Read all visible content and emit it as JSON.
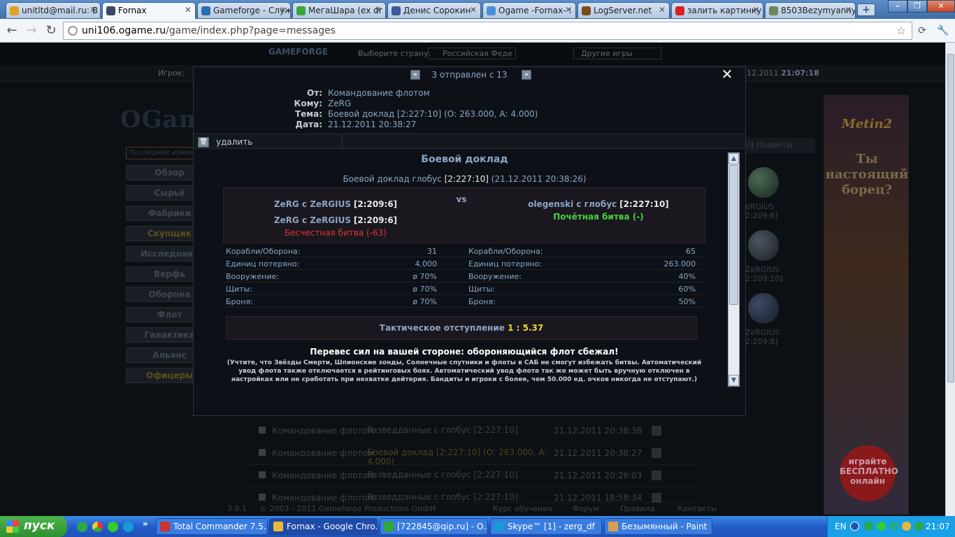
{
  "browser": {
    "tabs": [
      {
        "label": "unitltd@mail.ru: В",
        "color": "#e3a021"
      },
      {
        "label": "Fornax",
        "color": "#3a4a66"
      },
      {
        "label": "Gameforge - Служ",
        "color": "#2a6db0"
      },
      {
        "label": "МегаШара (ex dr",
        "color": "#3aa53a"
      },
      {
        "label": "Денис Сорокин",
        "color": "#3b5998"
      },
      {
        "label": "Ogame -Fornax- :",
        "color": "#4a90d9"
      },
      {
        "label": "LogServer.net",
        "color": "#7a4a1a"
      },
      {
        "label": "залить картинку",
        "color": "#d92020"
      },
      {
        "label": "8503Bezymyannyi",
        "color": "#6a8a5a"
      }
    ],
    "new_tab": "+",
    "window_buttons": [
      "–",
      "❐",
      "✕"
    ],
    "back": "←",
    "forward": "→",
    "reload": "↻",
    "url_host": "uni106.ogame.ru",
    "url_path": "/game/index.php?page=messages",
    "star": "☆",
    "wrench": "🔧"
  },
  "page": {
    "gameforge_logo": "GAMEFORGE",
    "country_label": "Выберите страну:",
    "country_value": "Российская Феде",
    "other_games": "Другие игры",
    "player_label": "Игрок:",
    "server_time": "12.2011",
    "server_clock": "21:07:18",
    "ogame_logo": "OGam",
    "search_placeholder": "Последние измен",
    "menu": [
      {
        "label": "Обзор",
        "gold": false
      },
      {
        "label": "Сырьё",
        "gold": false
      },
      {
        "label": "Фабрики",
        "gold": false
      },
      {
        "label": "Скупщик",
        "gold": true
      },
      {
        "label": "Исследован",
        "gold": false
      },
      {
        "label": "Верфь",
        "gold": false
      },
      {
        "label": "Оборона",
        "gold": false
      },
      {
        "label": "Флот",
        "gold": false
      },
      {
        "label": "Галактика",
        "gold": false
      },
      {
        "label": "Альянс",
        "gold": false
      },
      {
        "label": "Офицеры",
        "gold": true
      }
    ],
    "planets_header": "/3 Планеты",
    "planets": [
      {
        "name": "eRGIUS",
        "coords": "2:209:6]"
      },
      {
        "name": "ZeRGIUS",
        "coords": "2:209:10]"
      },
      {
        "name": "ZeRGIUS",
        "coords": "2:209:8]"
      }
    ],
    "ad": {
      "brand": "Metin2",
      "line1": "Ты",
      "line2": "настоящий",
      "line3": "борец?",
      "badge1": "играйте",
      "badge2": "БЕСПЛАТНО",
      "badge3": "онлайн"
    },
    "messages": [
      {
        "from": "Командование флотом",
        "subject": "Разведданные с глобус [2:227:10]",
        "date": "21.12.2011 20:38:38"
      },
      {
        "from": "Командование флотом",
        "subject": "Боевой доклад [2:227:10] (О: 263.000, А: 4.000)",
        "date": "21.12.2011 20:38:27"
      },
      {
        "from": "Командование флотом",
        "subject": "Разведданные с глобус [2:227:10]",
        "date": "21.12.2011 20:26:03"
      },
      {
        "from": "Командование флотом",
        "subject": "Разведданные с глобус [2:227:10]",
        "date": "21.12.2011 18:58:34"
      }
    ],
    "footer": {
      "version": "3.0.1",
      "copyright": "© 2003 - 2011 Gameforge Productions GmbH",
      "links": [
        "Курс обучения",
        "Форум",
        "Правила",
        "Контакты"
      ]
    }
  },
  "modal": {
    "pager_text": "3 отправлен с",
    "pager_current": "3",
    "pager_total": "13",
    "prev_symbol": "«",
    "next_symbol": "»",
    "close_symbol": "✕",
    "header": [
      {
        "label": "От:",
        "value": "Командование флотом"
      },
      {
        "label": "Кому:",
        "value": "ZeRG"
      },
      {
        "label": "Тема:",
        "value": "Боевой доклад [2:227:10] (О: 263.000, А: 4.000)"
      },
      {
        "label": "Дата:",
        "value": "21.12.2011 20:38:27"
      }
    ],
    "delete_label": "удалить",
    "report": {
      "title": "Боевой доклад",
      "subtitle_pre": "Боевой доклад глобус",
      "subtitle_coords": "[2:227:10]",
      "subtitle_date": "(21.12.2011 20:38:26)",
      "vs": "vs",
      "attacker": {
        "line1_name": "ZeRG с ZeRGIUS",
        "line1_coords": "[2:209:6]",
        "line2_name": "ZeRG с ZeRGIUS",
        "line2_coords": "[2:209:6]",
        "honor": "Бесчестная битва",
        "honor_val": "(-63)"
      },
      "defender": {
        "name": "olegenski с глобус",
        "coords": "[2:227:10]",
        "honor": "Почётная битва (-)"
      },
      "stats": [
        {
          "label": "Корабли/Оборона:",
          "att": "31",
          "def": "65"
        },
        {
          "label": "Единиц потеряно:",
          "att": "4.000",
          "def": "263.000"
        },
        {
          "label": "Вооружение:",
          "att": "ø 70%",
          "def": "40%"
        },
        {
          "label": "Щиты:",
          "att": "ø 70%",
          "def": "60%"
        },
        {
          "label": "Броня:",
          "att": "ø 70%",
          "def": "50%"
        }
      ],
      "retreat_label": "Тактическое отступление",
      "retreat_value": "1 : 5.37",
      "note_head": "Перевес сил на вашей стороне: обороняющийся флот сбежал!",
      "note_text": "(Учтите, что Звёзды Смерти, Шпионские зонды, Солнечные спутники и флоты в САБ не смогут избежать битвы. Автоматический увод флота также отключается в рейтинговых боях. Автоматический увод флота так же может быть вручную отключен в настройках или не сработать при нехватке дейтерия. Бандиты и игроки с более, чем 50.000 ед. очков никогда не отступают.)"
    }
  },
  "taskbar": {
    "start": "пуск",
    "more": "»",
    "tasks": [
      {
        "label": "Total Commander 7.5...",
        "color": "#c33"
      },
      {
        "label": "Fornax - Google Chro...",
        "color": "#e8b838"
      },
      {
        "label": "[722845@qip.ru] - О...",
        "color": "#3a3"
      },
      {
        "label": "Skype™ [1] - zerg_df",
        "color": "#1a9ad6"
      },
      {
        "label": "Безымянный - Paint",
        "color": "#d9a050"
      }
    ],
    "lang": "EN",
    "clock": "21:07"
  }
}
